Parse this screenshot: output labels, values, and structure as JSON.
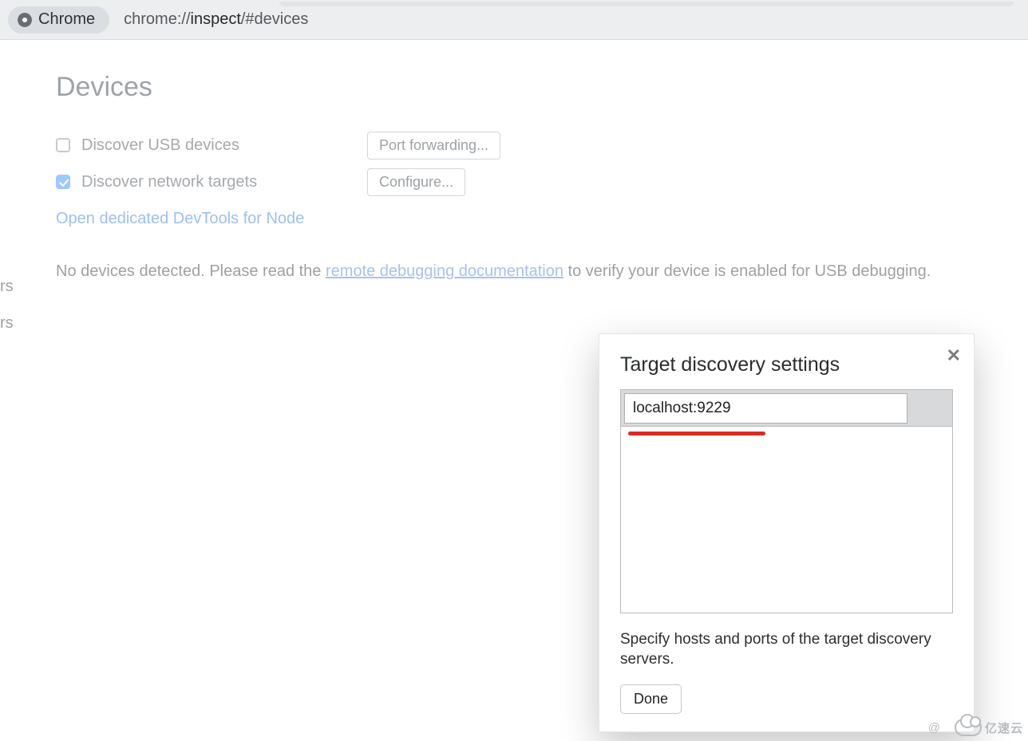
{
  "tab": {
    "label": "Chrome"
  },
  "url": {
    "prefix": "chrome://",
    "bold": "inspect",
    "suffix": "/#devices"
  },
  "page": {
    "title": "Devices",
    "usb_row": {
      "label": "Discover USB devices",
      "checked": false,
      "button": "Port forwarding..."
    },
    "net_row": {
      "label": "Discover network targets",
      "checked": true,
      "button": "Configure..."
    },
    "node_link": "Open dedicated DevTools for Node",
    "status_prefix": "No devices detected. Please read the ",
    "status_link": "remote debugging documentation",
    "status_suffix": " to verify your device is enabled for USB debugging."
  },
  "side": {
    "frag1": "rs",
    "frag2": "rs"
  },
  "dialog": {
    "title": "Target discovery settings",
    "input_value": "localhost:9229",
    "desc": "Specify hosts and ports of the target discovery servers.",
    "done": "Done"
  },
  "watermark": {
    "at": "@",
    "brand": "亿速云"
  }
}
